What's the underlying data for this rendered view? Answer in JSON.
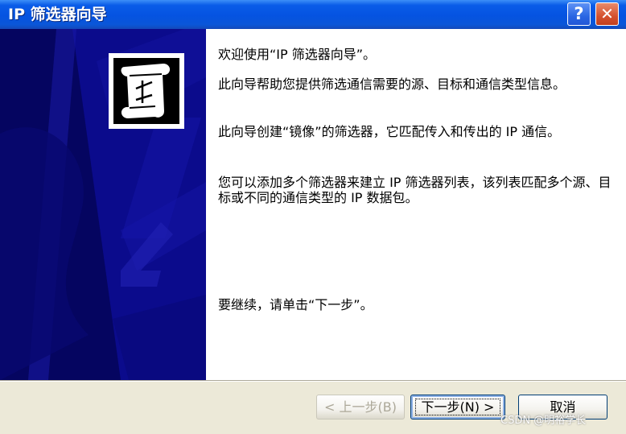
{
  "window": {
    "title": "IP 筛选器向导"
  },
  "titlebar_buttons": {
    "help": "?",
    "close": "✕"
  },
  "content": {
    "welcome": "欢迎使用“IP 筛选器向导”。",
    "description": "此向导帮助您提供筛选通信需要的源、目标和通信类型信息。",
    "mirror": "此向导创建“镜像”的筛选器，它匹配传入和传出的 IP 通信。",
    "list_info": "您可以添加多个筛选器来建立 IP 筛选器列表，该列表匹配多个源、目标或不同的通信类型的 IP 数据包。",
    "continue": "要继续，请单击“下一步”。"
  },
  "buttons": {
    "back": "< 上一步(B)",
    "next": "下一步(N) >",
    "cancel": "取消"
  },
  "watermark": "CSDN @明裕学长",
  "colors": {
    "titlebar": "#0553e1",
    "sidebar": "#0b0b8c",
    "content_bg": "#ffffff",
    "dialog_bg": "#ece9d8"
  },
  "icons": {
    "wizard": "scroll-arrow-icon",
    "help": "help-icon",
    "close": "close-icon"
  }
}
